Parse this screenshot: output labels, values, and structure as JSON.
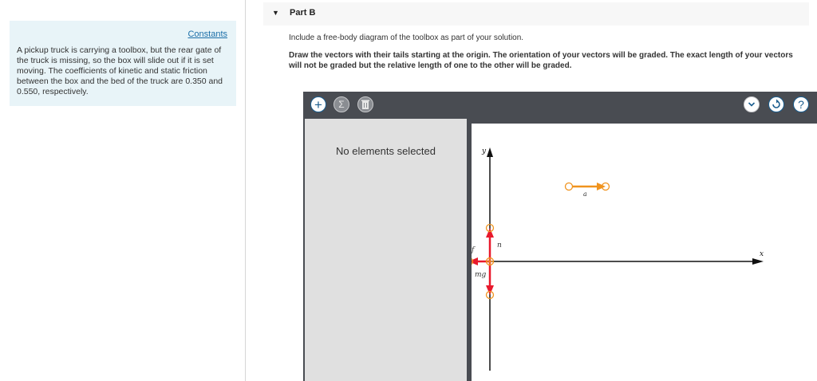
{
  "sidebar": {
    "constants_link": "Constants",
    "problem_text": "A pickup truck is carrying a toolbox, but the rear gate of the truck is missing, so the box will slide out if it is set moving. The coefficients of kinetic and static friction between the box and the bed of the truck are 0.350 and 0.550, respectively."
  },
  "part": {
    "title": "Part B",
    "instruction": "Include a free-body diagram of the toolbox as part of your solution.",
    "task": "Draw the vectors with their tails starting at the origin. The orientation of your vectors will be graded. The exact length of your vectors will not be graded but the relative length of one to the other will be graded."
  },
  "toolbar": {
    "add_icon": "plus-icon",
    "sum_icon": "sigma-icon",
    "delete_icon": "trash-icon",
    "dropdown_icon": "chevron-down-icon",
    "reset_icon": "reset-icon",
    "help_icon": "help-icon",
    "help_symbol": "?"
  },
  "panel": {
    "status_text": "No elements selected"
  },
  "diagram": {
    "axis_x_label": "x",
    "axis_y_label": "y",
    "vectors": [
      {
        "label": "n",
        "direction": "up",
        "color": "#e8192c"
      },
      {
        "label": "f",
        "direction": "left",
        "color": "#e8192c"
      },
      {
        "label": "mg",
        "direction": "down",
        "color": "#e8192c"
      }
    ],
    "acceleration": {
      "label": "a",
      "direction": "right",
      "color": "#f0931e"
    }
  },
  "colors": {
    "vector": "#e8192c",
    "handle": "#f0931e",
    "toolbar_bg": "#494c52",
    "info_bg": "#e8f4f8",
    "link": "#1a6ea8"
  }
}
